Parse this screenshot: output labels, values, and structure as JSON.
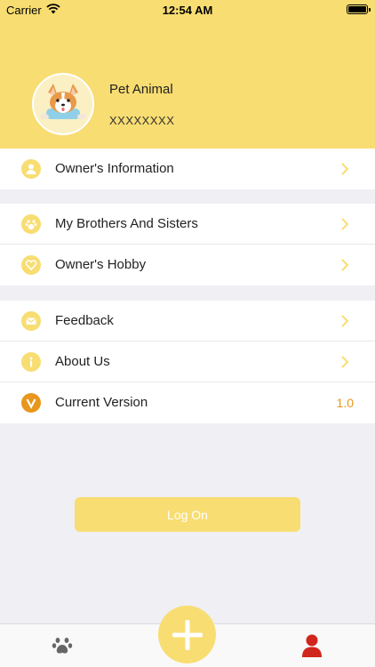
{
  "status_bar": {
    "carrier": "Carrier",
    "time": "12:54 AM"
  },
  "profile": {
    "name": "Pet Animal",
    "id": "XXXXXXXX"
  },
  "groups": [
    {
      "items": [
        {
          "label": "Owner's Information",
          "icon": "person-icon"
        }
      ]
    },
    {
      "items": [
        {
          "label": "My Brothers And Sisters",
          "icon": "paw-icon"
        },
        {
          "label": "Owner's Hobby",
          "icon": "heart-icon"
        }
      ]
    },
    {
      "items": [
        {
          "label": "Feedback",
          "icon": "mail-icon"
        },
        {
          "label": "About Us",
          "icon": "info-icon"
        },
        {
          "label": "Current Version",
          "icon": "version-icon",
          "value": "1.0"
        }
      ]
    }
  ],
  "logon_label": "Log On",
  "tabbar": {
    "left": "paw-icon",
    "center": "plus-icon",
    "right": "user-icon"
  },
  "colors": {
    "accent": "#f8dd72",
    "orange": "#e8961c",
    "active_tab": "#d0261c"
  }
}
